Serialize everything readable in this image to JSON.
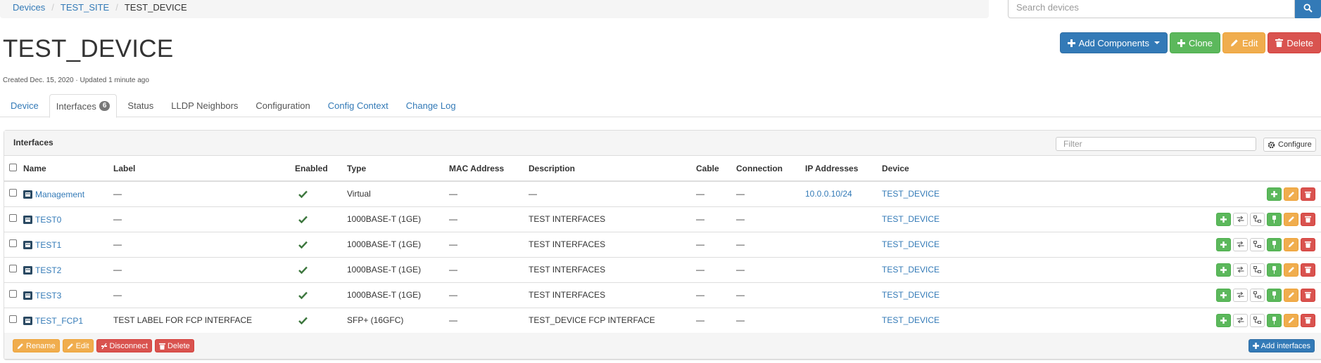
{
  "breadcrumb": {
    "devices": "Devices",
    "site": "TEST_SITE",
    "current": "TEST_DEVICE"
  },
  "search": {
    "placeholder": "Search devices"
  },
  "actions": {
    "add_components": "Add Components",
    "clone": "Clone",
    "edit": "Edit",
    "delete": "Delete"
  },
  "device": {
    "title": "TEST_DEVICE",
    "meta": "Created Dec. 15, 2020 · Updated 1 minute ago"
  },
  "tabs": [
    {
      "label": "Device"
    },
    {
      "label": "Interfaces",
      "badge": "6"
    },
    {
      "label": "Status"
    },
    {
      "label": "LLDP Neighbors"
    },
    {
      "label": "Configuration"
    },
    {
      "label": "Config Context"
    },
    {
      "label": "Change Log"
    }
  ],
  "panel": {
    "title": "Interfaces",
    "filter_placeholder": "Filter",
    "configure": "Configure"
  },
  "columns": [
    "Name",
    "Label",
    "Enabled",
    "Type",
    "MAC Address",
    "Description",
    "Cable",
    "Connection",
    "IP Addresses",
    "Device"
  ],
  "rows": [
    {
      "name": "Management",
      "label": "—",
      "type": "Virtual",
      "mac": "—",
      "description": "—",
      "cable": "—",
      "connection": "—",
      "ip": "10.0.0.10/24",
      "device": "TEST_DEVICE"
    },
    {
      "name": "TEST0",
      "label": "—",
      "type": "1000BASE-T (1GE)",
      "mac": "—",
      "description": "TEST INTERFACES",
      "cable": "—",
      "connection": "—",
      "ip": "",
      "device": "TEST_DEVICE"
    },
    {
      "name": "TEST1",
      "label": "—",
      "type": "1000BASE-T (1GE)",
      "mac": "—",
      "description": "TEST INTERFACES",
      "cable": "—",
      "connection": "—",
      "ip": "",
      "device": "TEST_DEVICE"
    },
    {
      "name": "TEST2",
      "label": "—",
      "type": "1000BASE-T (1GE)",
      "mac": "—",
      "description": "TEST INTERFACES",
      "cable": "—",
      "connection": "—",
      "ip": "",
      "device": "TEST_DEVICE"
    },
    {
      "name": "TEST3",
      "label": "—",
      "type": "1000BASE-T (1GE)",
      "mac": "—",
      "description": "TEST INTERFACES",
      "cable": "—",
      "connection": "—",
      "ip": "",
      "device": "TEST_DEVICE"
    },
    {
      "name": "TEST_FCP1",
      "label": "TEST LABEL FOR FCP INTERFACE",
      "type": "SFP+ (16GFC)",
      "mac": "—",
      "description": "TEST_DEVICE FCP INTERFACE",
      "cable": "—",
      "connection": "—",
      "ip": "",
      "device": "TEST_DEVICE"
    }
  ],
  "footer": {
    "rename": "Rename",
    "edit": "Edit",
    "disconnect": "Disconnect",
    "delete": "Delete",
    "add_interfaces": "Add interfaces"
  }
}
